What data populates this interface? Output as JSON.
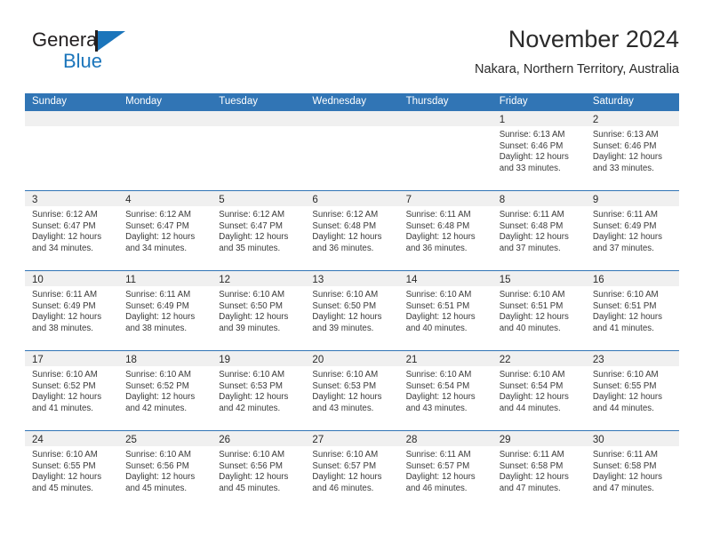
{
  "brand": {
    "word_top": "General",
    "word_bottom": "Blue",
    "mark_color": "#1b75bb",
    "text_color": "#231f20"
  },
  "header": {
    "title": "November 2024",
    "subtitle": "Nakara, Northern Territory, Australia"
  },
  "theme": {
    "header_blue": "#3175b5",
    "day_band_gray": "#f0f0f0",
    "text_dark": "#2a2a2a"
  },
  "labels": {
    "sunrise_prefix": "Sunrise:",
    "sunset_prefix": "Sunset:",
    "daylight_prefix": "Daylight:"
  },
  "day_headers": [
    "Sunday",
    "Monday",
    "Tuesday",
    "Wednesday",
    "Thursday",
    "Friday",
    "Saturday"
  ],
  "weeks": [
    [
      {
        "day": "",
        "sunrise": "",
        "sunset": "",
        "daylight_l1": "",
        "daylight_l2": ""
      },
      {
        "day": "",
        "sunrise": "",
        "sunset": "",
        "daylight_l1": "",
        "daylight_l2": ""
      },
      {
        "day": "",
        "sunrise": "",
        "sunset": "",
        "daylight_l1": "",
        "daylight_l2": ""
      },
      {
        "day": "",
        "sunrise": "",
        "sunset": "",
        "daylight_l1": "",
        "daylight_l2": ""
      },
      {
        "day": "",
        "sunrise": "",
        "sunset": "",
        "daylight_l1": "",
        "daylight_l2": ""
      },
      {
        "day": "1",
        "sunrise": "Sunrise: 6:13 AM",
        "sunset": "Sunset: 6:46 PM",
        "daylight_l1": "Daylight: 12 hours",
        "daylight_l2": "and 33 minutes."
      },
      {
        "day": "2",
        "sunrise": "Sunrise: 6:13 AM",
        "sunset": "Sunset: 6:46 PM",
        "daylight_l1": "Daylight: 12 hours",
        "daylight_l2": "and 33 minutes."
      }
    ],
    [
      {
        "day": "3",
        "sunrise": "Sunrise: 6:12 AM",
        "sunset": "Sunset: 6:47 PM",
        "daylight_l1": "Daylight: 12 hours",
        "daylight_l2": "and 34 minutes."
      },
      {
        "day": "4",
        "sunrise": "Sunrise: 6:12 AM",
        "sunset": "Sunset: 6:47 PM",
        "daylight_l1": "Daylight: 12 hours",
        "daylight_l2": "and 34 minutes."
      },
      {
        "day": "5",
        "sunrise": "Sunrise: 6:12 AM",
        "sunset": "Sunset: 6:47 PM",
        "daylight_l1": "Daylight: 12 hours",
        "daylight_l2": "and 35 minutes."
      },
      {
        "day": "6",
        "sunrise": "Sunrise: 6:12 AM",
        "sunset": "Sunset: 6:48 PM",
        "daylight_l1": "Daylight: 12 hours",
        "daylight_l2": "and 36 minutes."
      },
      {
        "day": "7",
        "sunrise": "Sunrise: 6:11 AM",
        "sunset": "Sunset: 6:48 PM",
        "daylight_l1": "Daylight: 12 hours",
        "daylight_l2": "and 36 minutes."
      },
      {
        "day": "8",
        "sunrise": "Sunrise: 6:11 AM",
        "sunset": "Sunset: 6:48 PM",
        "daylight_l1": "Daylight: 12 hours",
        "daylight_l2": "and 37 minutes."
      },
      {
        "day": "9",
        "sunrise": "Sunrise: 6:11 AM",
        "sunset": "Sunset: 6:49 PM",
        "daylight_l1": "Daylight: 12 hours",
        "daylight_l2": "and 37 minutes."
      }
    ],
    [
      {
        "day": "10",
        "sunrise": "Sunrise: 6:11 AM",
        "sunset": "Sunset: 6:49 PM",
        "daylight_l1": "Daylight: 12 hours",
        "daylight_l2": "and 38 minutes."
      },
      {
        "day": "11",
        "sunrise": "Sunrise: 6:11 AM",
        "sunset": "Sunset: 6:49 PM",
        "daylight_l1": "Daylight: 12 hours",
        "daylight_l2": "and 38 minutes."
      },
      {
        "day": "12",
        "sunrise": "Sunrise: 6:10 AM",
        "sunset": "Sunset: 6:50 PM",
        "daylight_l1": "Daylight: 12 hours",
        "daylight_l2": "and 39 minutes."
      },
      {
        "day": "13",
        "sunrise": "Sunrise: 6:10 AM",
        "sunset": "Sunset: 6:50 PM",
        "daylight_l1": "Daylight: 12 hours",
        "daylight_l2": "and 39 minutes."
      },
      {
        "day": "14",
        "sunrise": "Sunrise: 6:10 AM",
        "sunset": "Sunset: 6:51 PM",
        "daylight_l1": "Daylight: 12 hours",
        "daylight_l2": "and 40 minutes."
      },
      {
        "day": "15",
        "sunrise": "Sunrise: 6:10 AM",
        "sunset": "Sunset: 6:51 PM",
        "daylight_l1": "Daylight: 12 hours",
        "daylight_l2": "and 40 minutes."
      },
      {
        "day": "16",
        "sunrise": "Sunrise: 6:10 AM",
        "sunset": "Sunset: 6:51 PM",
        "daylight_l1": "Daylight: 12 hours",
        "daylight_l2": "and 41 minutes."
      }
    ],
    [
      {
        "day": "17",
        "sunrise": "Sunrise: 6:10 AM",
        "sunset": "Sunset: 6:52 PM",
        "daylight_l1": "Daylight: 12 hours",
        "daylight_l2": "and 41 minutes."
      },
      {
        "day": "18",
        "sunrise": "Sunrise: 6:10 AM",
        "sunset": "Sunset: 6:52 PM",
        "daylight_l1": "Daylight: 12 hours",
        "daylight_l2": "and 42 minutes."
      },
      {
        "day": "19",
        "sunrise": "Sunrise: 6:10 AM",
        "sunset": "Sunset: 6:53 PM",
        "daylight_l1": "Daylight: 12 hours",
        "daylight_l2": "and 42 minutes."
      },
      {
        "day": "20",
        "sunrise": "Sunrise: 6:10 AM",
        "sunset": "Sunset: 6:53 PM",
        "daylight_l1": "Daylight: 12 hours",
        "daylight_l2": "and 43 minutes."
      },
      {
        "day": "21",
        "sunrise": "Sunrise: 6:10 AM",
        "sunset": "Sunset: 6:54 PM",
        "daylight_l1": "Daylight: 12 hours",
        "daylight_l2": "and 43 minutes."
      },
      {
        "day": "22",
        "sunrise": "Sunrise: 6:10 AM",
        "sunset": "Sunset: 6:54 PM",
        "daylight_l1": "Daylight: 12 hours",
        "daylight_l2": "and 44 minutes."
      },
      {
        "day": "23",
        "sunrise": "Sunrise: 6:10 AM",
        "sunset": "Sunset: 6:55 PM",
        "daylight_l1": "Daylight: 12 hours",
        "daylight_l2": "and 44 minutes."
      }
    ],
    [
      {
        "day": "24",
        "sunrise": "Sunrise: 6:10 AM",
        "sunset": "Sunset: 6:55 PM",
        "daylight_l1": "Daylight: 12 hours",
        "daylight_l2": "and 45 minutes."
      },
      {
        "day": "25",
        "sunrise": "Sunrise: 6:10 AM",
        "sunset": "Sunset: 6:56 PM",
        "daylight_l1": "Daylight: 12 hours",
        "daylight_l2": "and 45 minutes."
      },
      {
        "day": "26",
        "sunrise": "Sunrise: 6:10 AM",
        "sunset": "Sunset: 6:56 PM",
        "daylight_l1": "Daylight: 12 hours",
        "daylight_l2": "and 45 minutes."
      },
      {
        "day": "27",
        "sunrise": "Sunrise: 6:10 AM",
        "sunset": "Sunset: 6:57 PM",
        "daylight_l1": "Daylight: 12 hours",
        "daylight_l2": "and 46 minutes."
      },
      {
        "day": "28",
        "sunrise": "Sunrise: 6:11 AM",
        "sunset": "Sunset: 6:57 PM",
        "daylight_l1": "Daylight: 12 hours",
        "daylight_l2": "and 46 minutes."
      },
      {
        "day": "29",
        "sunrise": "Sunrise: 6:11 AM",
        "sunset": "Sunset: 6:58 PM",
        "daylight_l1": "Daylight: 12 hours",
        "daylight_l2": "and 47 minutes."
      },
      {
        "day": "30",
        "sunrise": "Sunrise: 6:11 AM",
        "sunset": "Sunset: 6:58 PM",
        "daylight_l1": "Daylight: 12 hours",
        "daylight_l2": "and 47 minutes."
      }
    ]
  ]
}
